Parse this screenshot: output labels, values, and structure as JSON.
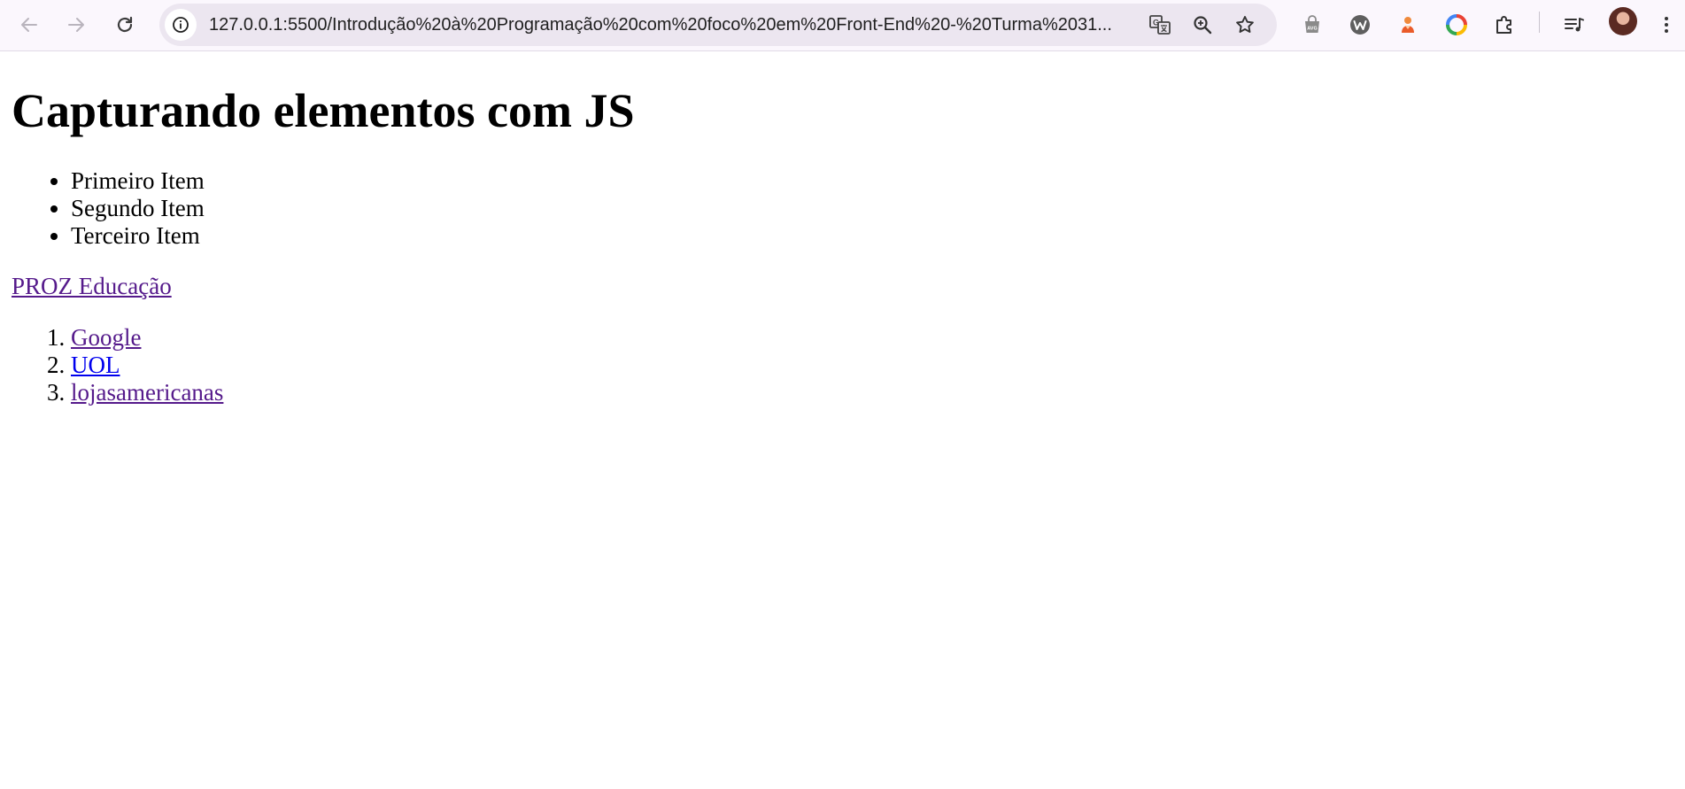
{
  "browser": {
    "url": "127.0.0.1:5500/Introdução%20à%20Programação%20com%20foco%20em%20Front-End%20-%20Turma%2031...",
    "colors": {
      "toolbar_bg": "#fbf7fd",
      "omnibox_bg": "#ece6f0"
    }
  },
  "page": {
    "heading": "Capturando elementos com JS",
    "bullet_items": [
      "Primeiro Item",
      "Segundo Item",
      "Terceiro Item"
    ],
    "proz_link": "PROZ Educação",
    "ordered_links": [
      "Google",
      "UOL",
      "lojasamericanas"
    ],
    "colors": {
      "visited_link": "#551a8b",
      "link": "#0000ee"
    }
  }
}
